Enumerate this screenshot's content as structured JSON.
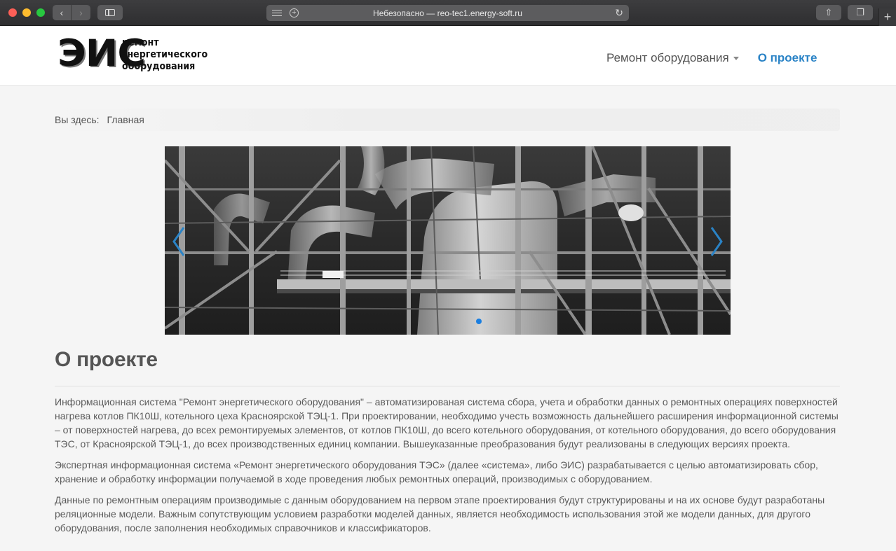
{
  "browser": {
    "address": "Небезопасно — reo-tec1.energy-soft.ru",
    "back_glyph": "‹",
    "forward_glyph": "›",
    "reload_glyph": "↻",
    "share_glyph": "⇧",
    "tabs_glyph": "❐",
    "newtab_glyph": "+",
    "plus_glyph": "+"
  },
  "logo": {
    "big": "ЭИС",
    "line1": "ремонт",
    "line2": "энергетического",
    "line3": "оборудования"
  },
  "nav": {
    "repair": "Ремонт оборудования",
    "about": "О проекте"
  },
  "breadcrumb": {
    "prefix": "Вы здесь:",
    "home": "Главная"
  },
  "carousel": {
    "total_slides": 1,
    "active_slide": 1
  },
  "page": {
    "title": "О проекте",
    "paragraphs": [
      "Информационная система \"Ремонт энергетического оборудования\" – автоматизированая система сбора, учета и обработки данных о ремонтных операциях поверхностей нагрева котлов ПК10Ш, котельного цеха Красноярской ТЭЦ-1. При проектировании, необходимо учесть возможность дальнейшего расширения информационной системы – от поверхностей нагрева, до всех ремонтируемых элементов, от котлов ПК10Ш, до всего котельного оборудования, от котельного оборудования, до всего оборудования ТЭС, от Красноярской ТЭЦ-1, до всех производственных единиц компании.  Вышеуказанные преобразования будут реализованы в следующих версиях проекта.",
      "Экспертная информационная система «Ремонт энергетического оборудования ТЭС» (далее «система», либо ЭИС) разрабатывается с целью автоматизировать сбор, хранение и обработку информации получаемой в ходе проведения любых ремонтных операций, производимых с оборудованием.",
      "Данные по ремонтным операциям производимые с данным оборудованием на первом этапе проектирования будут структурированы и на их основе будут разработаны реляционные модели. Важным сопутствующим условием разработки моделей данных, является необходимость использования этой же модели данных, для другого оборудования, после заполнения необходимых справочников и классификаторов."
    ]
  },
  "colors": {
    "accent": "#2a83c6",
    "carousel_dot": "#1a7ee0",
    "text": "#5a5a5a"
  }
}
